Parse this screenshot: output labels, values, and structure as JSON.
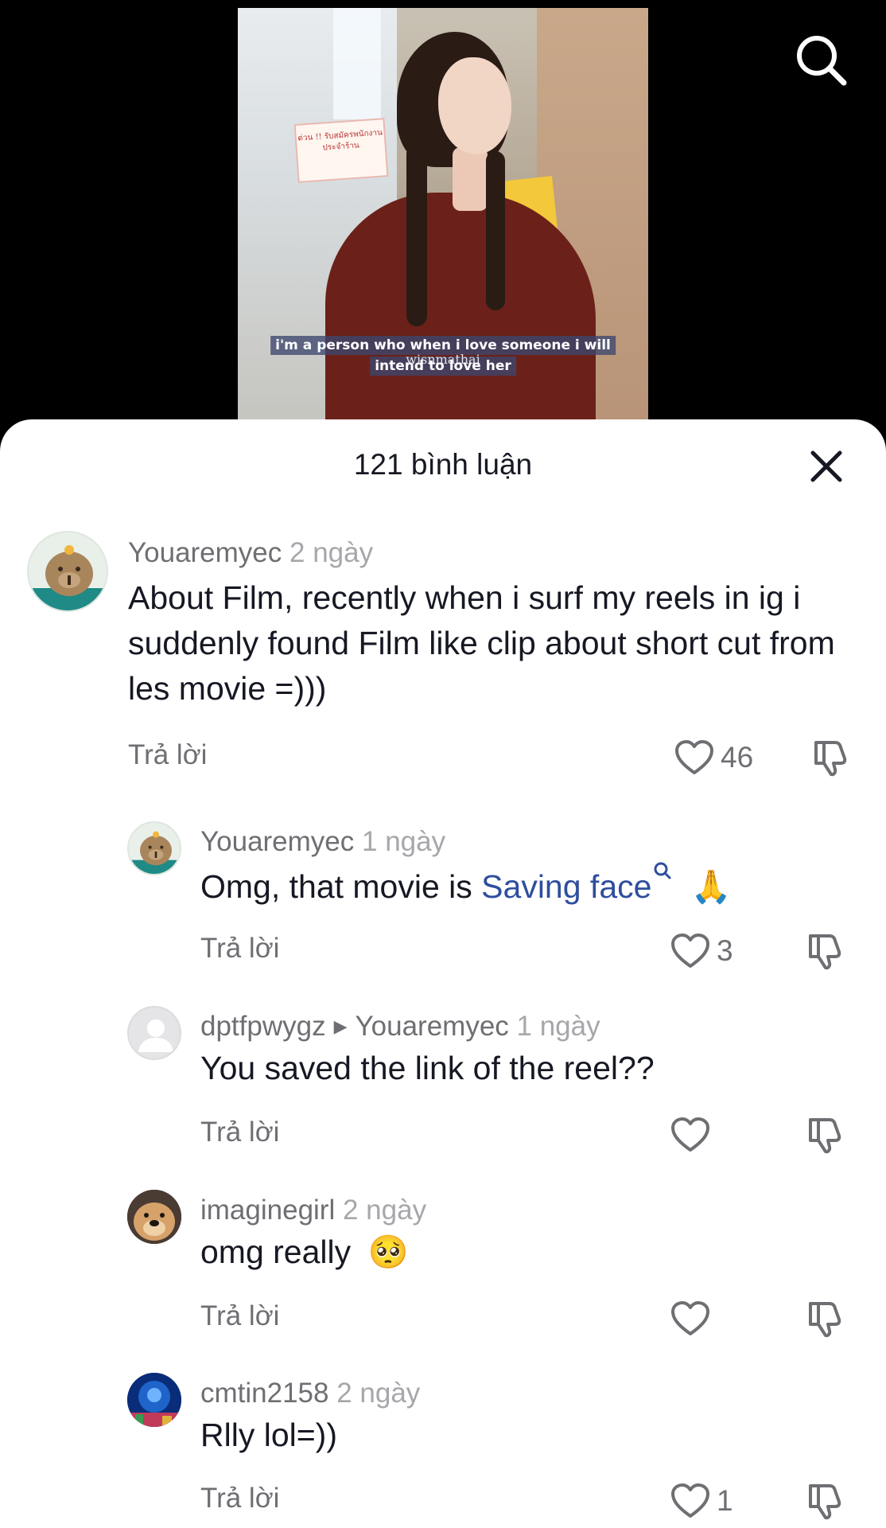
{
  "video": {
    "caption_line1": "i'm a person who when i love someone i will",
    "caption_line2": "intend to love her",
    "watermark": "wisnmathai",
    "sign_text": "ด่วน !! รับสมัครพนักงาน ประจำร้าน"
  },
  "icons": {
    "search": "search-icon",
    "close": "close-icon",
    "like": "heart-icon",
    "dislike": "thumbs-down-icon"
  },
  "header": {
    "title": "121 bình luận"
  },
  "comments": [
    {
      "username": "Youaremyec",
      "date": "2 ngày",
      "text": "About Film, recently when i surf my reels in ig i suddenly found Film like clip about short cut from les movie =)))",
      "reply_label": "Trả lời",
      "likes": "46"
    },
    {
      "username": "Youaremyec",
      "date": "1 ngày",
      "text_before": "Omg, that movie is ",
      "link": "Saving face",
      "emoji": "🙏",
      "reply_label": "Trả lời",
      "likes": "3"
    },
    {
      "username": "dptfpwygz",
      "reply_to": "Youaremyec",
      "date": "1 ngày",
      "text": "You saved the link of the reel??",
      "reply_label": "Trả lời",
      "likes": ""
    },
    {
      "username": "imaginegirl",
      "date": "2 ngày",
      "text": "omg really",
      "emoji": "🥺",
      "reply_label": "Trả lời",
      "likes": ""
    },
    {
      "username": "cmtin2158",
      "date": "2 ngày",
      "text": "Rlly lol=))",
      "reply_label": "Trả lời",
      "likes": "1"
    }
  ],
  "colors": {
    "text_primary": "#161823",
    "text_secondary": "#6e6f73",
    "text_date": "#a6a7ab",
    "link": "#2e4e9e"
  }
}
